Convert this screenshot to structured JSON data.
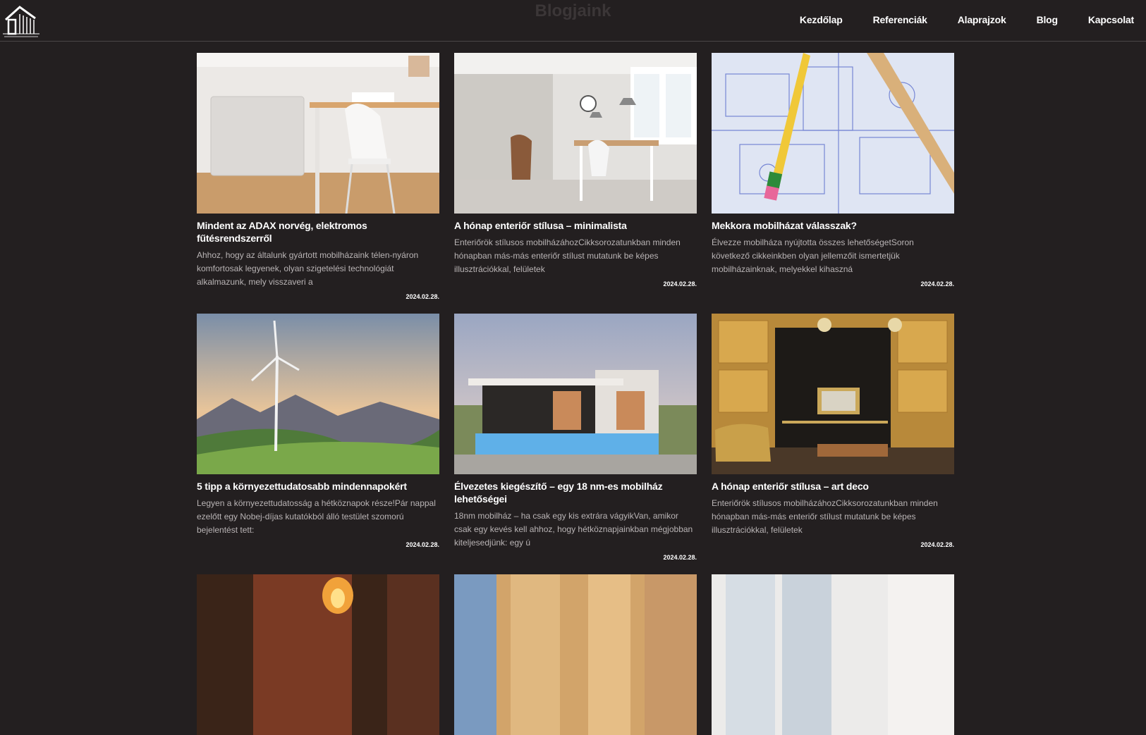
{
  "header": {
    "heading": "Blogjaink",
    "nav": [
      "Kezdőlap",
      "Referenciák",
      "Alaprajzok",
      "Blog",
      "Kapcsolat"
    ]
  },
  "posts": [
    {
      "title": "Mindent az ADAX norvég, elektromos fűtésrendszerről",
      "excerpt": "Ahhoz, hogy az általunk gyártott mobilházaink télen-nyáron komfortosak legyenek, olyan szigetelési technológiát alkalmazunk, mely visszaveri a",
      "date": "2024.02.28."
    },
    {
      "title": "A hónap enteriőr stílusa – minimalista",
      "excerpt": "Enteriőrök stílusos mobilházáhozCikksorozatunkban minden hónapban más-más enteriőr stílust mutatunk be képes illusztrációkkal, felületek",
      "date": "2024.02.28."
    },
    {
      "title": "Mekkora mobilházat válasszak?",
      "excerpt": "Élvezze mobilháza nyújtotta összes lehetőségetSoron következő cikkeinkben olyan jellemzőit ismertetjük mobilházainknak, melyekkel kihaszná",
      "date": "2024.02.28."
    },
    {
      "title": "5 tipp a környezettudatosabb mindennapokért",
      "excerpt": "Legyen a környezettudatosság a hétköznapok része!Pár nappal ezelőtt egy Nobej-díjas kutatókból álló testület szomorú bejelentést tett:",
      "date": "2024.02.28."
    },
    {
      "title": "Élvezetes kiegészítő – egy 18 nm-es mobilház lehetőségei",
      "excerpt": "18nm mobilház – ha csak egy kis extrára vágyikVan, amikor csak egy kevés kell ahhoz, hogy hétköznapjainkban mégjobban kiteljesedjünk: egy ú",
      "date": "2024.02.28."
    },
    {
      "title": "A hónap enteriőr stílusa – art deco",
      "excerpt": "Enteriőrök stílusos mobilházáhozCikksorozatunkban minden hónapban más-más enteriőr stílust mutatunk be képes illusztrációkkal, felületek",
      "date": "2024.02.28."
    }
  ]
}
